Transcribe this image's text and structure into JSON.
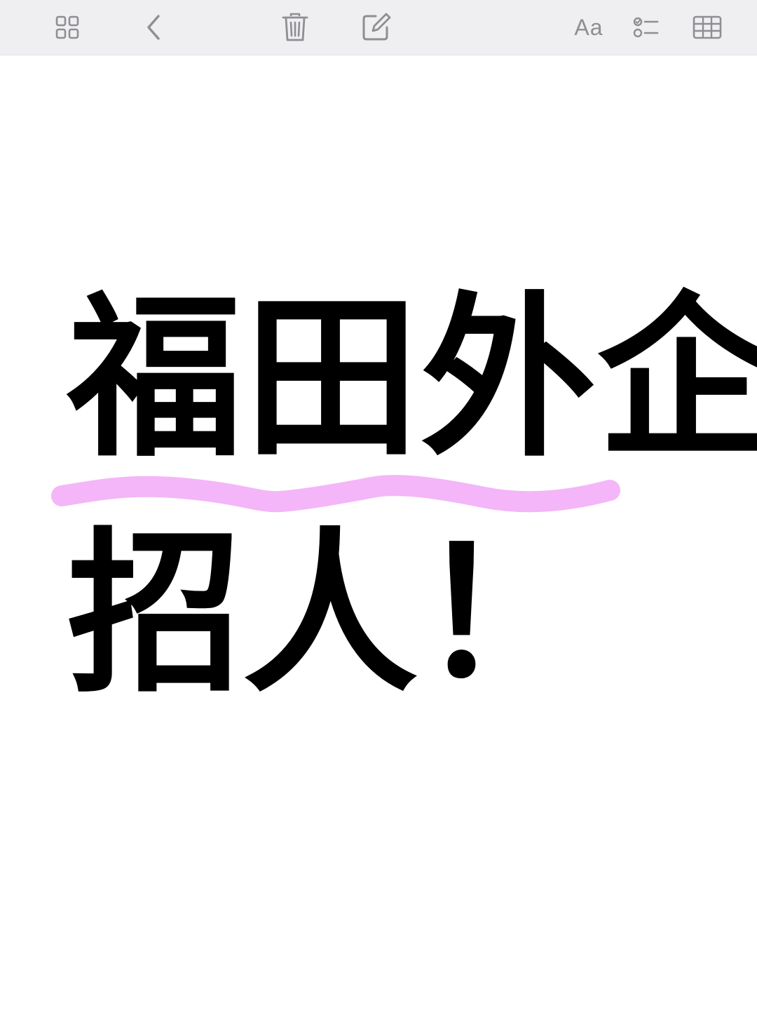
{
  "toolbar": {
    "buttons": [
      {
        "name": "gallery-view",
        "icon": "grid-icon"
      },
      {
        "name": "back",
        "icon": "chevron-left-icon"
      },
      {
        "name": "delete",
        "icon": "trash-icon"
      },
      {
        "name": "compose",
        "icon": "compose-icon"
      },
      {
        "name": "text-format",
        "icon": "text-format-icon",
        "label": "Aa"
      },
      {
        "name": "checklist",
        "icon": "checklist-icon"
      },
      {
        "name": "table",
        "icon": "table-icon"
      }
    ],
    "icon_color": "#8e8e93",
    "background": "#efeff1"
  },
  "note": {
    "line1": "福田外企",
    "line2": "招人！",
    "text_color": "#000000",
    "highlight_color": "#f4b6f8"
  }
}
